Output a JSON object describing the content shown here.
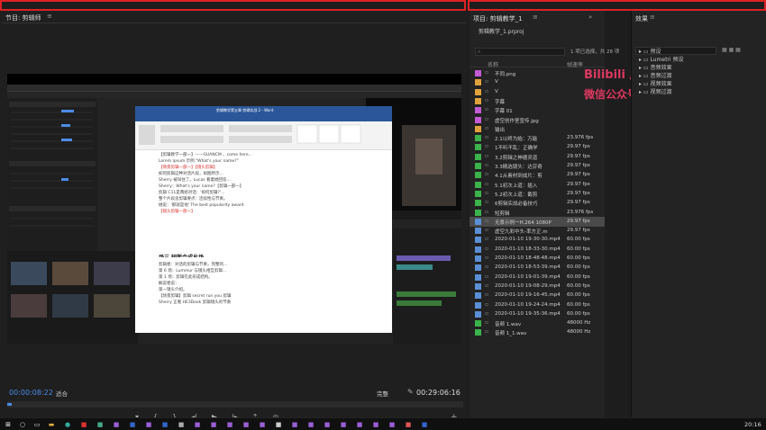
{
  "program_panel": {
    "title": "节目: 剪辑师",
    "timecode_current": "00:00:08:22",
    "fit": "适合",
    "quality": "完整",
    "timecode_duration": "00:29:06:16",
    "progress_fraction": 0.01
  },
  "project_panel": {
    "tab": "项目: 剪辑教学_1",
    "file": "剪辑教学_1.prproj",
    "count": "1 项已选择，共 28 项",
    "col_name": "名称",
    "col_rate": "帧速率",
    "items": [
      {
        "name": "不同.png",
        "rate": "",
        "color": "#c35ad6"
      },
      {
        "name": "V",
        "rate": "",
        "color": "#e0a23c"
      },
      {
        "name": "V",
        "rate": "",
        "color": "#e0a23c"
      },
      {
        "name": "字幕",
        "rate": "",
        "color": "#e0a23c"
      },
      {
        "name": "字幕 01",
        "rate": "",
        "color": "#c35ad6"
      },
      {
        "name": "虚空创作室宣传.jpg",
        "rate": "",
        "color": "#c35ad6"
      },
      {
        "name": "输出",
        "rate": "",
        "color": "#e0a23c"
      },
      {
        "name": "2.1以终为始：万能",
        "rate": "23.976 fps",
        "color": "#3bb34a"
      },
      {
        "name": "1不听不乱：正确学",
        "rate": "29.97 fps",
        "color": "#3bb34a"
      },
      {
        "name": "3.2剪辑之神德灵道",
        "rate": "29.97 fps",
        "color": "#3bb34a"
      },
      {
        "name": "3.3精选镜头：达芬奇",
        "rate": "29.97 fps",
        "color": "#3bb34a"
      },
      {
        "name": "4.1从素材到成片：剪",
        "rate": "29.97 fps",
        "color": "#3bb34a"
      },
      {
        "name": "5.1初次上道：插入",
        "rate": "29.97 fps",
        "color": "#3bb34a"
      },
      {
        "name": "5.2初次上道：截剪",
        "rate": "29.97 fps",
        "color": "#3bb34a"
      },
      {
        "name": "6剪辑实战必备技巧",
        "rate": "29.97 fps",
        "color": "#3bb34a"
      },
      {
        "name": "短剪辑",
        "rate": "23.976 fps",
        "color": "#3bb34a"
      },
      {
        "name": "无景示例一H.264 1080P",
        "rate": "29.97 fps",
        "color": "#5a8fd6",
        "selected": true
      },
      {
        "name": "虚空九彩中头-率方正.m",
        "rate": "29.97 fps",
        "color": "#5a8fd6"
      },
      {
        "name": "2020-01-10 19-30-30.mp4",
        "rate": "60.00 fps",
        "color": "#5a8fd6"
      },
      {
        "name": "2020-01-10 18-33-30.mp4",
        "rate": "60.00 fps",
        "color": "#5a8fd6"
      },
      {
        "name": "2020-01-10 18-48-48.mp4",
        "rate": "60.00 fps",
        "color": "#5a8fd6"
      },
      {
        "name": "2020-01-10 18-53-39.mp4",
        "rate": "60.00 fps",
        "color": "#5a8fd6"
      },
      {
        "name": "2020-01-10 19-01-39.mp4",
        "rate": "60.00 fps",
        "color": "#5a8fd6"
      },
      {
        "name": "2020-01-10 19-08-29.mp4",
        "rate": "60.00 fps",
        "color": "#5a8fd6"
      },
      {
        "name": "2020-01-10 19-16-45.mp4",
        "rate": "60.00 fps",
        "color": "#5a8fd6"
      },
      {
        "name": "2020-01-10 19-24-24.mp4",
        "rate": "60.00 fps",
        "color": "#5a8fd6"
      },
      {
        "name": "2020-01-10 19-35-36.mp4",
        "rate": "60.00 fps",
        "color": "#5a8fd6"
      },
      {
        "name": "音频 1.wav",
        "rate": "48000 Hz",
        "color": "#3bb34a"
      },
      {
        "name": "音频 1_1.wav",
        "rate": "48000 Hz",
        "color": "#3bb34a"
      }
    ]
  },
  "watermark": {
    "line1": "Bilibili 虚空光影",
    "line2": "微信公众号 虚空影像"
  },
  "effects_panel": {
    "tab": "效果",
    "items": [
      "预设",
      "Lumetri 预设",
      "音频效果",
      "音频过渡",
      "视频效果",
      "视频过渡"
    ]
  },
  "word_doc": {
    "title": "剪辑教学第五章 剪辑实战 2 - Word",
    "heading": "场三 短暂合成片场",
    "lines": [
      "【剪辑教学一部一】——GUANCM 、come here...",
      "Lorem ipsum 示例 \"What's your name?\"",
      "如何剪辑这种对话片段，如图所示...",
      "Sherry 被叫住了。Lucas 看着她回答...",
      "【情景剪辑一部一】【镜头剪辑】",
      "Sherry：What's your name?【剪辑一部一】",
      "剪辑 C11是两组对话：'如何剪辑?'...",
      "整个片段含剪辑要点：连续性与节奏。",
      "她说：'那就是他' The best popularity award",
      "【镜头剪辑一部一】",
      "场三 短暂合成片场",
      "剪辑者：对话的剪辑与节奏，完整的...",
      "第 6 场：Lummur 与镜头相互剪辑...",
      "第 1 场：剪辑在此形成结构。",
      "解说者说：",
      "第一镜头介绍。",
      "【场景剪辑】剪辑 secret run you 剪辑",
      "Sherry 正看 HE3Dook 剪辑镜头的节奏"
    ]
  },
  "taskbar": {
    "clock": "20:16"
  }
}
